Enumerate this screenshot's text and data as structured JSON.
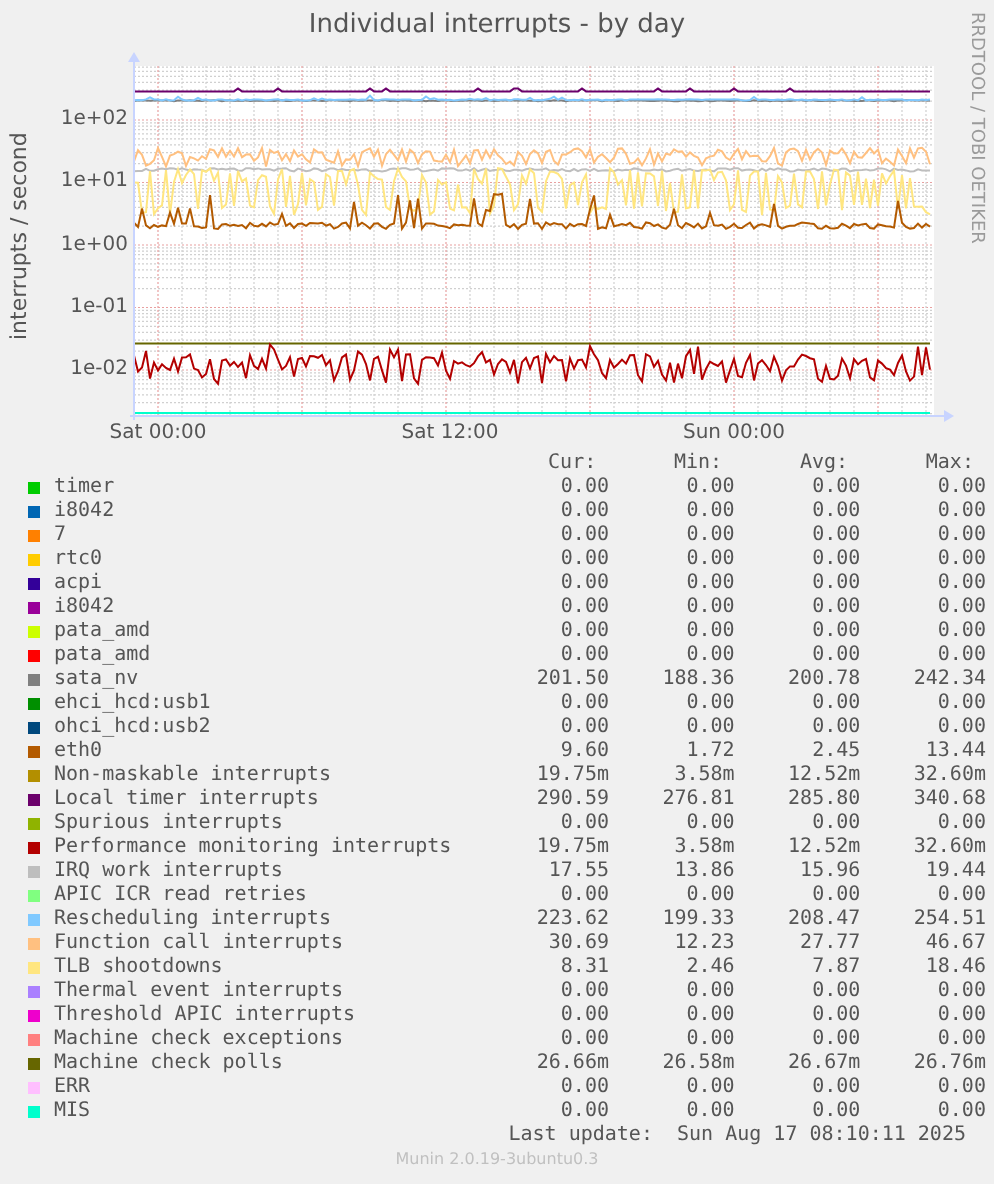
{
  "graph": {
    "title": "Individual interrupts - by day",
    "ylabel": "interrupts / second",
    "side_text": "RRDTOOL / TOBI OETIKER",
    "yticks": [
      "1e+02",
      "1e+01",
      "1e+00",
      "1e-01",
      "1e-02"
    ],
    "xticks": [
      "Sat 00:00",
      "Sat 12:00",
      "Sun 00:00"
    ]
  },
  "legend": {
    "columns": [
      "Cur:",
      "Min:",
      "Avg:",
      "Max:"
    ],
    "rows": [
      {
        "name": "timer",
        "color": "#00cc00",
        "cur": "0.00",
        "min": "0.00",
        "avg": "0.00",
        "max": "0.00"
      },
      {
        "name": "i8042",
        "color": "#0066b3",
        "cur": "0.00",
        "min": "0.00",
        "avg": "0.00",
        "max": "0.00"
      },
      {
        "name": "7",
        "color": "#ff8000",
        "cur": "0.00",
        "min": "0.00",
        "avg": "0.00",
        "max": "0.00"
      },
      {
        "name": "rtc0",
        "color": "#ffcc00",
        "cur": "0.00",
        "min": "0.00",
        "avg": "0.00",
        "max": "0.00"
      },
      {
        "name": "acpi",
        "color": "#330099",
        "cur": "0.00",
        "min": "0.00",
        "avg": "0.00",
        "max": "0.00"
      },
      {
        "name": "i8042",
        "color": "#990099",
        "cur": "0.00",
        "min": "0.00",
        "avg": "0.00",
        "max": "0.00"
      },
      {
        "name": "pata_amd",
        "color": "#ccff00",
        "cur": "0.00",
        "min": "0.00",
        "avg": "0.00",
        "max": "0.00"
      },
      {
        "name": "pata_amd",
        "color": "#ff0000",
        "cur": "0.00",
        "min": "0.00",
        "avg": "0.00",
        "max": "0.00"
      },
      {
        "name": "sata_nv",
        "color": "#808080",
        "cur": "201.50",
        "min": "188.36",
        "avg": "200.78",
        "max": "242.34"
      },
      {
        "name": "ehci_hcd:usb1",
        "color": "#008f00",
        "cur": "0.00",
        "min": "0.00",
        "avg": "0.00",
        "max": "0.00"
      },
      {
        "name": "ohci_hcd:usb2",
        "color": "#00487d",
        "cur": "0.00",
        "min": "0.00",
        "avg": "0.00",
        "max": "0.00"
      },
      {
        "name": "eth0",
        "color": "#b35a00",
        "cur": "9.60",
        "min": "1.72",
        "avg": "2.45",
        "max": "13.44"
      },
      {
        "name": "Non-maskable interrupts",
        "color": "#b38f00",
        "cur": "19.75m",
        "min": "3.58m",
        "avg": "12.52m",
        "max": "32.60m"
      },
      {
        "name": "Local timer interrupts",
        "color": "#6b006b",
        "cur": "290.59",
        "min": "276.81",
        "avg": "285.80",
        "max": "340.68"
      },
      {
        "name": "Spurious interrupts",
        "color": "#8fb300",
        "cur": "0.00",
        "min": "0.00",
        "avg": "0.00",
        "max": "0.00"
      },
      {
        "name": "Performance monitoring interrupts",
        "color": "#b30000",
        "cur": "19.75m",
        "min": "3.58m",
        "avg": "12.52m",
        "max": "32.60m"
      },
      {
        "name": "IRQ work interrupts",
        "color": "#bebebe",
        "cur": "17.55",
        "min": "13.86",
        "avg": "15.96",
        "max": "19.44"
      },
      {
        "name": "APIC ICR read retries",
        "color": "#80ff80",
        "cur": "0.00",
        "min": "0.00",
        "avg": "0.00",
        "max": "0.00"
      },
      {
        "name": "Rescheduling interrupts",
        "color": "#80c9ff",
        "cur": "223.62",
        "min": "199.33",
        "avg": "208.47",
        "max": "254.51"
      },
      {
        "name": "Function call interrupts",
        "color": "#ffc080",
        "cur": "30.69",
        "min": "12.23",
        "avg": "27.77",
        "max": "46.67"
      },
      {
        "name": "TLB shootdowns",
        "color": "#ffe680",
        "cur": "8.31",
        "min": "2.46",
        "avg": "7.87",
        "max": "18.46"
      },
      {
        "name": "Thermal event interrupts",
        "color": "#aa80ff",
        "cur": "0.00",
        "min": "0.00",
        "avg": "0.00",
        "max": "0.00"
      },
      {
        "name": "Threshold APIC interrupts",
        "color": "#ee00cc",
        "cur": "0.00",
        "min": "0.00",
        "avg": "0.00",
        "max": "0.00"
      },
      {
        "name": "Machine check exceptions",
        "color": "#ff8080",
        "cur": "0.00",
        "min": "0.00",
        "avg": "0.00",
        "max": "0.00"
      },
      {
        "name": "Machine check polls",
        "color": "#666600",
        "cur": "26.66m",
        "min": "26.58m",
        "avg": "26.67m",
        "max": "26.76m"
      },
      {
        "name": "ERR",
        "color": "#ffbfff",
        "cur": "0.00",
        "min": "0.00",
        "avg": "0.00",
        "max": "0.00"
      },
      {
        "name": "MIS",
        "color": "#00ffcc",
        "cur": "0.00",
        "min": "0.00",
        "avg": "0.00",
        "max": "0.00"
      }
    ]
  },
  "footer": {
    "last_update": "Last update:  Sun Aug 17 08:10:11 2025",
    "version": "Munin 2.0.19-3ubuntu0.3"
  }
}
